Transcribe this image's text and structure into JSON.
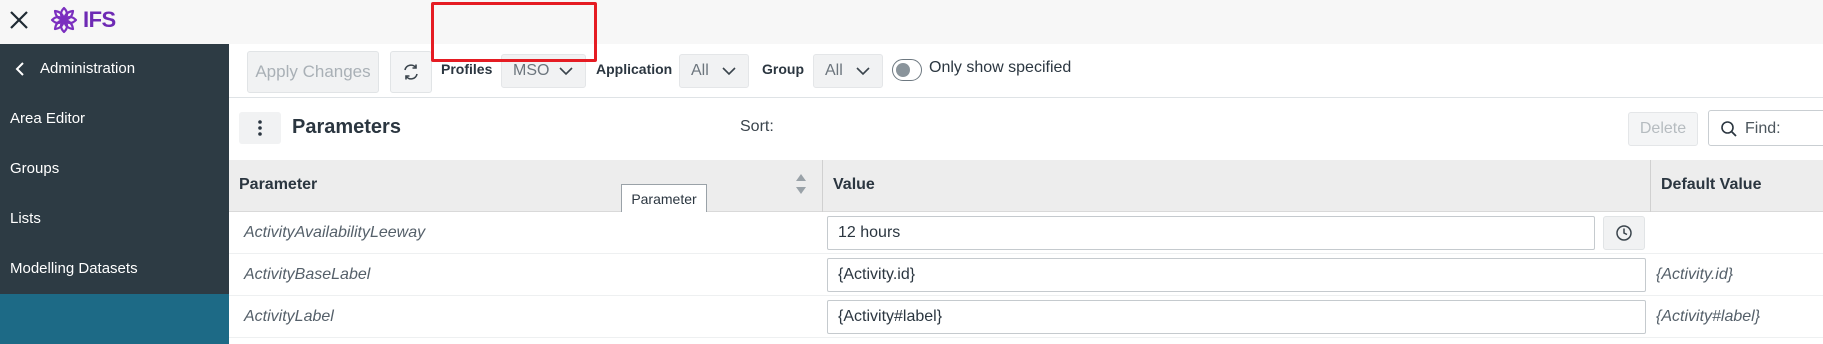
{
  "header": {
    "logo_text": "IFS",
    "close_icon": "close-icon",
    "brand_color": "#6e2ab4"
  },
  "sidebar": {
    "back_label": "Administration",
    "items": [
      {
        "label": "Area Editor"
      },
      {
        "label": "Groups"
      },
      {
        "label": "Lists"
      },
      {
        "label": "Modelling Datasets"
      },
      {
        "label": ""
      }
    ],
    "active_color": "#1d6a86",
    "bg_color": "#2d3b44"
  },
  "toolbar": {
    "apply_label": "Apply Changes",
    "refresh_icon": "refresh-icon",
    "profiles_label": "Profiles",
    "profiles_value": "MSO",
    "application_label": "Application",
    "application_value": "All",
    "group_label": "Group",
    "group_value": "All",
    "toggle_label": "Only show specified",
    "toggle_on": false,
    "highlight_color": "#e51c23"
  },
  "list": {
    "title": "Parameters",
    "sort_label": "Sort:",
    "delete_label": "Delete",
    "find_placeholder": "Find:"
  },
  "table": {
    "columns": [
      "Parameter",
      "Value",
      "Default Value"
    ],
    "tooltip": "Parameter",
    "rows": [
      {
        "parameter": "ActivityAvailabilityLeeway",
        "value": "12 hours",
        "default": ""
      },
      {
        "parameter": "ActivityBaseLabel",
        "value": "{Activity.id}",
        "default": "{Activity.id}"
      },
      {
        "parameter": "ActivityLabel",
        "value": "{Activity#label}",
        "default": "{Activity#label}"
      }
    ]
  }
}
